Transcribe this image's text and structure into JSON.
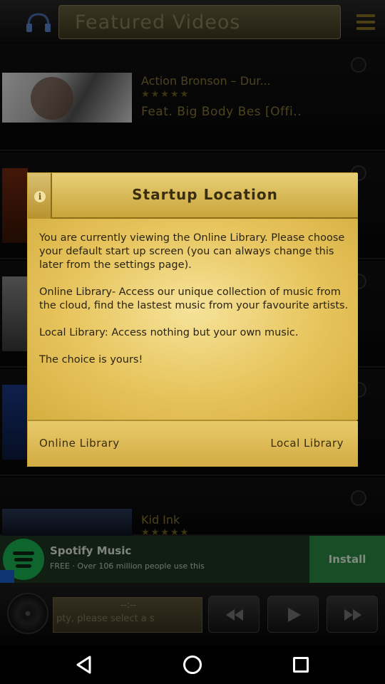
{
  "header": {
    "title": "Featured Videos",
    "logo_icon": "headphones-logo-icon",
    "menu_icon": "menu-icon"
  },
  "videos": [
    {
      "title": "Action Bronson – Dur...",
      "stars": "★★★★★",
      "subtitle": "Feat. Big Body Bes [Offi.."
    },
    {
      "title": "Kid Ink",
      "stars": "★★★★★"
    }
  ],
  "dialog": {
    "title": "Startup Location",
    "info_icon": "info-icon",
    "message": "You are currently viewing the Online Library. Please choose your default start up screen (you can always change this later from the settings page).\n\nOnline Library- Access our unique collection of music from the cloud, find the lastest music from your favourite artists.\n\nLocal Library: Access nothing but your own music.\n\nThe choice is yours!",
    "buttons": {
      "online": "Online Library",
      "local": "Local Library"
    }
  },
  "ad": {
    "title": "Spotify Music",
    "subtitle": "FREE · Over 106 million people use this",
    "cta": "Install",
    "brand_color": "#1db954"
  },
  "player": {
    "time": "--:--",
    "status_text": "pty, please select a s"
  },
  "colors": {
    "dialog_gold": "#d8b64a",
    "dialog_text": "#2a2410",
    "install_green": "#2d8c45"
  }
}
